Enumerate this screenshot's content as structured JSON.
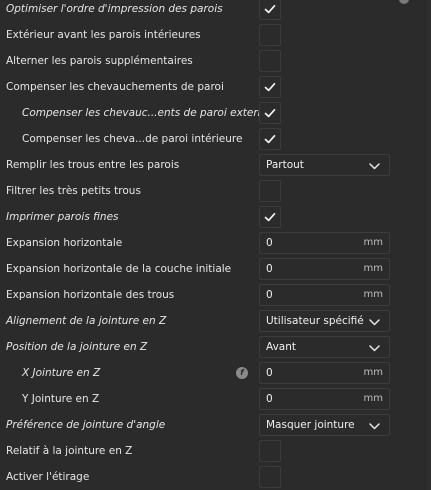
{
  "settings": [
    {
      "label": "Optimiser l'ordre d'impression des parois",
      "italic": true,
      "indent": false,
      "control": "checkbox",
      "checked": true
    },
    {
      "label": "Extérieur avant les parois intérieures",
      "italic": false,
      "indent": false,
      "control": "checkbox",
      "checked": false
    },
    {
      "label": "Alterner les parois supplémentaires",
      "italic": false,
      "indent": false,
      "control": "checkbox",
      "checked": false
    },
    {
      "label": "Compenser les chevauchements de paroi",
      "italic": false,
      "indent": false,
      "control": "checkbox",
      "checked": true
    },
    {
      "label": "Compenser les chevauc...ents de paroi externe",
      "italic": true,
      "indent": true,
      "control": "checkbox",
      "checked": true
    },
    {
      "label": "Compenser les cheva...de paroi intérieure",
      "italic": false,
      "indent": true,
      "control": "checkbox",
      "checked": true
    },
    {
      "label": "Remplir les trous entre les parois",
      "italic": false,
      "indent": false,
      "control": "select",
      "value": "Partout"
    },
    {
      "label": "Filtrer les très petits trous",
      "italic": false,
      "indent": false,
      "control": "checkbox",
      "checked": false
    },
    {
      "label": "Imprimer parois fines",
      "italic": true,
      "indent": false,
      "control": "checkbox",
      "checked": true
    },
    {
      "label": "Expansion horizontale",
      "italic": false,
      "indent": false,
      "control": "number",
      "value": "0",
      "unit": "mm"
    },
    {
      "label": "Expansion horizontale de la couche initiale",
      "italic": false,
      "indent": false,
      "control": "number",
      "value": "0",
      "unit": "mm"
    },
    {
      "label": "Expansion horizontale des trous",
      "italic": false,
      "indent": false,
      "control": "number",
      "value": "0",
      "unit": "mm"
    },
    {
      "label": "Alignement de la jointure en Z",
      "italic": true,
      "indent": false,
      "control": "select",
      "value": "Utilisateur spécifié"
    },
    {
      "label": "Position de la jointure en Z",
      "italic": true,
      "indent": false,
      "control": "select",
      "value": "Avant"
    },
    {
      "label": "X Jointure en Z",
      "italic": true,
      "indent": true,
      "control": "number",
      "value": "0",
      "unit": "mm",
      "fx": true
    },
    {
      "label": "Y Jointure en Z",
      "italic": false,
      "indent": true,
      "control": "number",
      "value": "0",
      "unit": "mm"
    },
    {
      "label": "Préférence de jointure d'angle",
      "italic": true,
      "indent": false,
      "control": "select",
      "value": "Masquer jointure"
    },
    {
      "label": "Relatif à la jointure en Z",
      "italic": false,
      "indent": false,
      "control": "checkbox",
      "checked": false
    },
    {
      "label": "Activer l'étirage",
      "italic": false,
      "indent": false,
      "control": "checkbox",
      "checked": false
    }
  ],
  "fx_icon_glyph": "f",
  "icons": {
    "check": "check-icon",
    "chevron": "chevron-down-icon",
    "fx": "function-icon"
  }
}
